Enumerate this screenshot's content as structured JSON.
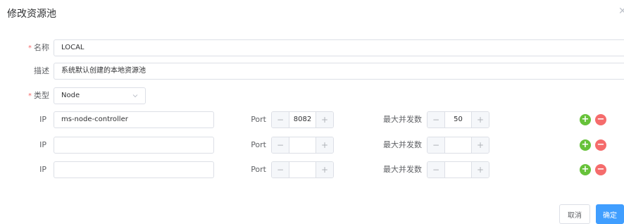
{
  "dialog": {
    "title": "修改资源池"
  },
  "form": {
    "name": {
      "label": "名称",
      "value": "LOCAL"
    },
    "description": {
      "label": "描述",
      "value": "系统默认创建的本地资源池"
    },
    "type": {
      "label": "类型",
      "value": "Node"
    },
    "required_mark": "*"
  },
  "nodes": [
    {
      "ip_label": "IP",
      "ip": "ms-node-controller",
      "port_label": "Port",
      "port": "8082",
      "concurrency_label": "最大并发数",
      "concurrency": "50"
    },
    {
      "ip_label": "IP",
      "ip": "",
      "port_label": "Port",
      "port": "",
      "concurrency_label": "最大并发数",
      "concurrency": ""
    },
    {
      "ip_label": "IP",
      "ip": "",
      "port_label": "Port",
      "port": "",
      "concurrency_label": "最大并发数",
      "concurrency": ""
    }
  ],
  "stepper": {
    "minus": "−",
    "plus": "+"
  },
  "row_actions": {
    "add": "+",
    "remove": "−"
  },
  "footer": {
    "cancel_label": "取消",
    "confirm_label": "确定"
  },
  "colors": {
    "primary": "#409eff",
    "success": "#67c23a",
    "danger": "#f56c6c",
    "border": "#dcdfe6"
  }
}
